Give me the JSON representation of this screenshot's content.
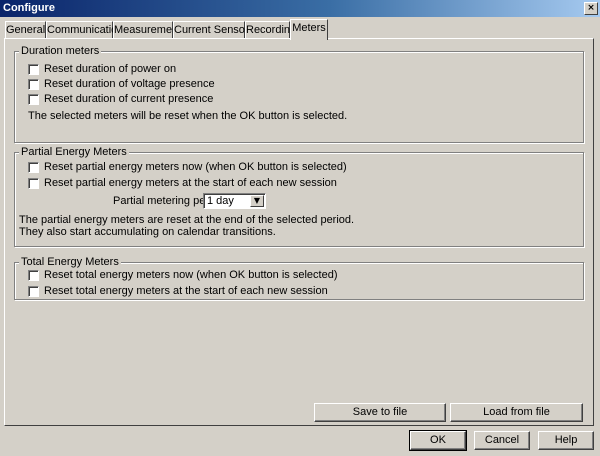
{
  "window": {
    "title": "Configure",
    "close_glyph": "×"
  },
  "tabs": [
    {
      "label": "General"
    },
    {
      "label": "Communication"
    },
    {
      "label": "Measurement"
    },
    {
      "label": "Current Sensors"
    },
    {
      "label": "Recording"
    },
    {
      "label": "Meters"
    }
  ],
  "duration": {
    "title": "Duration meters",
    "items": [
      {
        "label": "Reset duration of power on",
        "checked": false
      },
      {
        "label": "Reset duration of voltage presence",
        "checked": false
      },
      {
        "label": "Reset duration of current presence",
        "checked": false
      }
    ],
    "note": "The selected meters will be reset when the OK button is selected."
  },
  "partial": {
    "title": "Partial Energy Meters",
    "items": [
      {
        "label": "Reset partial energy meters now (when OK button is selected)",
        "checked": false
      },
      {
        "label": "Reset partial energy meters at the start of each new session",
        "checked": false
      }
    ],
    "period_label": "Partial metering period:",
    "period_value": "1 day",
    "note1": "The partial energy meters are reset at the end of the selected period.",
    "note2": "They also start accumulating on calendar transitions."
  },
  "total": {
    "title": "Total Energy Meters",
    "items": [
      {
        "label": "Reset total energy meters now (when OK button is selected)",
        "checked": false
      },
      {
        "label": "Reset total energy meters at the start of each new session",
        "checked": false
      }
    ]
  },
  "buttons": {
    "save": "Save to file",
    "load": "Load from file",
    "ok": "OK",
    "cancel": "Cancel",
    "help": "Help"
  }
}
